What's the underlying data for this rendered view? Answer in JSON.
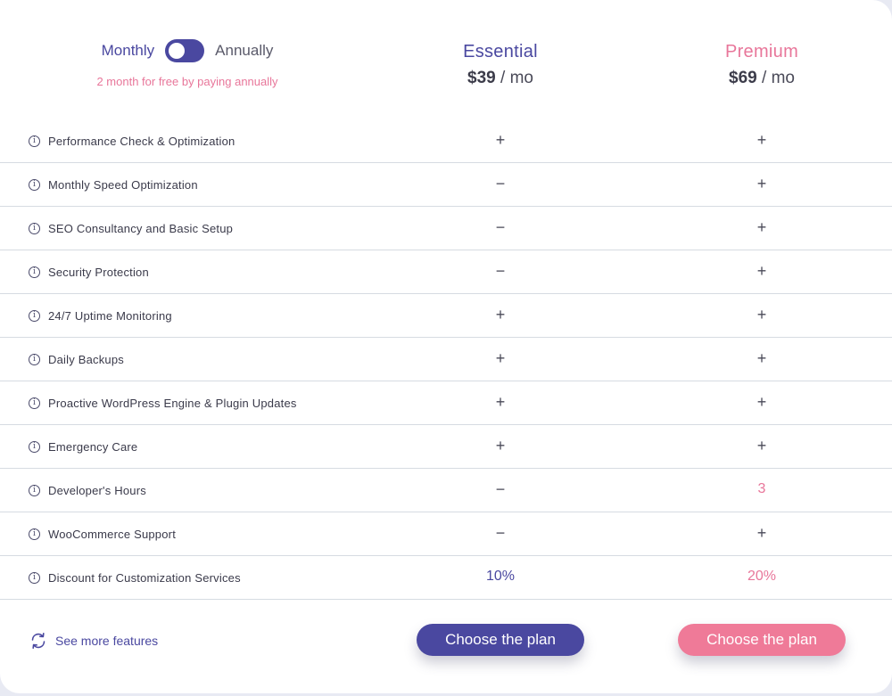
{
  "billing": {
    "monthly_label": "Monthly",
    "annually_label": "Annually",
    "promo": "2 month for free by paying annually"
  },
  "plans": [
    {
      "name": "Essential",
      "price": "$39",
      "per": " / mo",
      "color": "#4a48a0"
    },
    {
      "name": "Premium",
      "price": "$69",
      "per": " / mo",
      "color": "#e8769a"
    }
  ],
  "features": [
    {
      "label": "Performance Check & Optimization",
      "essential": "+",
      "premium": "+"
    },
    {
      "label": "Monthly Speed Optimization",
      "essential": "−",
      "premium": "+"
    },
    {
      "label": "SEO Consultancy and Basic Setup",
      "essential": "−",
      "premium": "+"
    },
    {
      "label": "Security Protection",
      "essential": "−",
      "premium": "+"
    },
    {
      "label": "24/7 Uptime Monitoring",
      "essential": "+",
      "premium": "+"
    },
    {
      "label": "Daily Backups",
      "essential": "+",
      "premium": "+"
    },
    {
      "label": "Proactive WordPress Engine & Plugin Updates",
      "essential": "+",
      "premium": "+"
    },
    {
      "label": "Emergency Care",
      "essential": "+",
      "premium": "+"
    },
    {
      "label": "Developer's Hours",
      "essential": "−",
      "premium": "3"
    },
    {
      "label": "WooCommerce Support",
      "essential": "−",
      "premium": "+"
    },
    {
      "label": "Discount for Customization Services",
      "essential": "10%",
      "premium": "20%"
    }
  ],
  "footer": {
    "see_more": "See more features",
    "choose_essential": "Choose the plan",
    "choose_premium": "Choose the plan"
  },
  "icons": {
    "info": "info-icon",
    "refresh": "refresh-icon",
    "toggle": "billing-toggle"
  }
}
